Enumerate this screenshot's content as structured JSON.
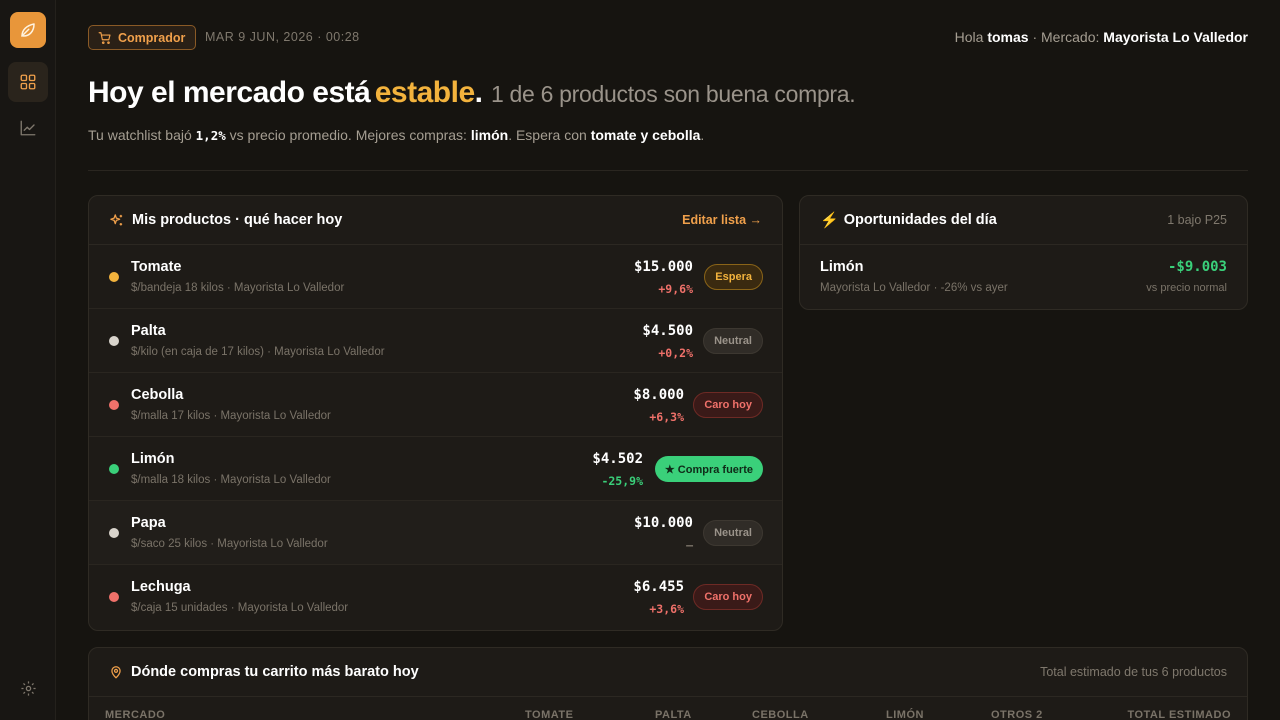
{
  "header": {
    "role": "Comprador",
    "date": "MAR 9 JUN, 2026 · 00:28",
    "greeting_prefix": "Hola",
    "user": "tomas",
    "market_label": "· Mercado:",
    "market": "Mayorista Lo Valledor"
  },
  "hero": {
    "title_prefix": "Hoy el mercado está",
    "title_state": "estable",
    "title_suffix": ".",
    "subtitle": "1 de 6 productos son buena compra."
  },
  "summary": {
    "text1": "Tu watchlist bajó",
    "pct": "1,2%",
    "text2": "vs precio promedio. Mejores compras:",
    "best": "limón",
    "text3": ". Espera con",
    "wait": "tomate y cebolla",
    "text4": "."
  },
  "products_card": {
    "title": "Mis productos · qué hacer hoy",
    "edit_link": "Editar lista →",
    "items": [
      {
        "name": "Tomate",
        "desc": "$/bandeja 18 kilos · Mayorista Lo Valledor",
        "price": "$15.000",
        "delta": "+9,6%",
        "badge": "Espera",
        "status_color": "#f3b33d",
        "delta_color": "#f0716a"
      },
      {
        "name": "Palta",
        "desc": "$/kilo (en caja de 17 kilos) · Mayorista Lo Valledor",
        "price": "$4.500",
        "delta": "+0,2%",
        "badge": "Neutral",
        "status_color": "#d9d4cc",
        "delta_color": "#f0716a"
      },
      {
        "name": "Cebolla",
        "desc": "$/malla 17 kilos · Mayorista Lo Valledor",
        "price": "$8.000",
        "delta": "+6,3%",
        "badge": "Caro hoy",
        "status_color": "#f0716a",
        "delta_color": "#f0716a"
      },
      {
        "name": "Limón",
        "desc": "$/malla 18 kilos · Mayorista Lo Valledor",
        "price": "$4.502",
        "delta": "-25,9%",
        "badge": "★ Compra fuerte",
        "status_color": "#3ad07a",
        "delta_color": "#3ad07a"
      },
      {
        "name": "Papa",
        "desc": "$/saco 25 kilos · Mayorista Lo Valledor",
        "price": "$10.000",
        "delta": "—",
        "badge": "Neutral",
        "status_color": "#d9d4cc",
        "delta_color": "#7a7368"
      },
      {
        "name": "Lechuga",
        "desc": "$/caja 15 unidades · Mayorista Lo Valledor",
        "price": "$6.455",
        "delta": "+3,6%",
        "badge": "Caro hoy",
        "status_color": "#f0716a",
        "delta_color": "#f0716a"
      }
    ]
  },
  "opportunities": {
    "title": "Oportunidades del día",
    "note": "1 bajo P25",
    "item": {
      "name": "Limón",
      "desc": "Mayorista Lo Valledor · -26% vs ayer",
      "value": "-$9.003",
      "note": "vs precio normal"
    }
  },
  "cart": {
    "title": "Dónde compras tu carrito más barato hoy",
    "note": "Total estimado de tus 6 productos",
    "columns": [
      "MERCADO",
      "TOMATE",
      "PALTA",
      "CEBOLLA",
      "LIMÓN",
      "OTROS 2",
      "TOTAL ESTIMADO"
    ]
  },
  "icons": {
    "logo": "leaf-icon",
    "nav": [
      "dashboard-grid-icon",
      "trend-chart-icon"
    ],
    "settings": "gear-icon"
  },
  "colors": {
    "accent": "#e8963a",
    "stable": "#f3b33d",
    "good": "#3ad07a",
    "bad": "#f0716a"
  }
}
